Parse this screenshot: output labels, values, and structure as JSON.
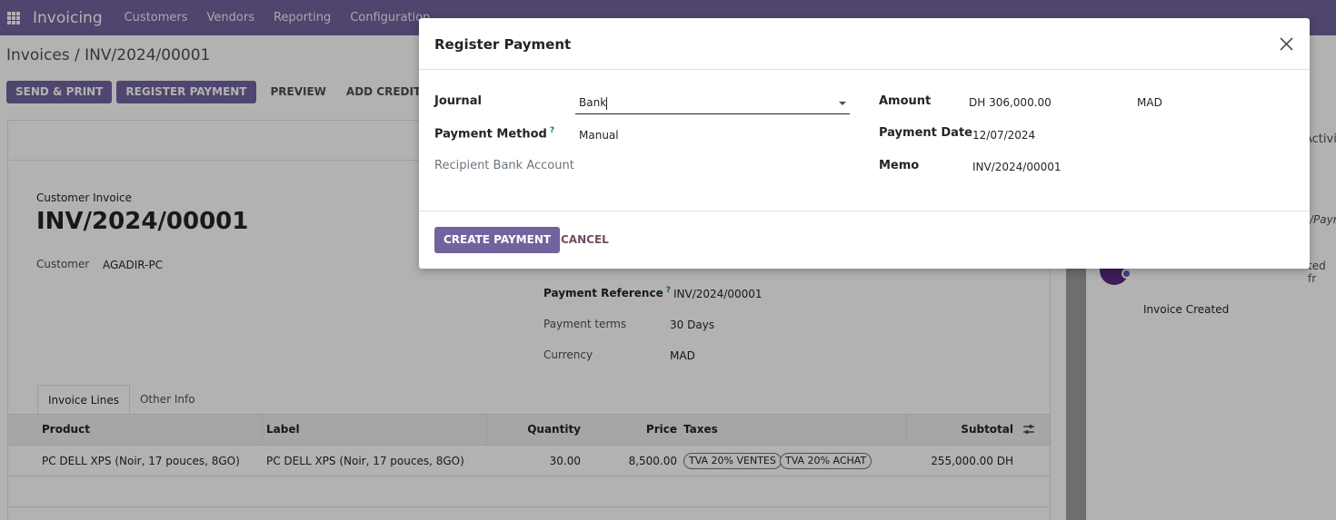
{
  "navbar": {
    "brand": "Invoicing",
    "menu": [
      "Customers",
      "Vendors",
      "Reporting",
      "Configuration"
    ]
  },
  "breadcrumb": "Invoices / INV/2024/00001",
  "actions": {
    "send_print": "SEND & PRINT",
    "register_payment": "REGISTER PAYMENT",
    "preview": "PREVIEW",
    "add_credit_note": "ADD CREDIT NOTE"
  },
  "invoice": {
    "type": "Customer Invoice",
    "name": "INV/2024/00001",
    "customer_label": "Customer",
    "customer": "AGADIR-PC",
    "payment_reference_label": "Payment Reference",
    "payment_reference": "INV/2024/00001",
    "payment_terms_label": "Payment terms",
    "payment_terms": "30 Days",
    "currency_label": "Currency",
    "currency": "MAD"
  },
  "tabs": [
    "Invoice Lines",
    "Other Info"
  ],
  "lines": {
    "headers": [
      "Product",
      "Label",
      "Quantity",
      "Price",
      "Taxes",
      "Subtotal"
    ],
    "rows": [
      {
        "product": "PC DELL XPS (Noir, 17 pouces, 8GO)",
        "label": "PC DELL XPS (Noir, 17 pouces, 8GO)",
        "quantity": "30.00",
        "price": "8,500.00",
        "taxes": [
          "TVA 20% VENTES",
          "TVA 20% ACHAT"
        ],
        "subtotal": "255,000.00 DH"
      }
    ]
  },
  "chatter": {
    "activities": "Activit",
    "payment_snip": "/Paym",
    "created_snip": "ted fr",
    "event": "Invoice Created"
  },
  "modal": {
    "title": "Register Payment",
    "journal_label": "Journal",
    "journal_value": "Bank",
    "payment_method_label": "Payment Method",
    "payment_method_value": "Manual",
    "recipient_bank_label": "Recipient Bank Account",
    "amount_label": "Amount",
    "amount_value": "DH 306,000.00",
    "amount_currency": "MAD",
    "payment_date_label": "Payment Date",
    "payment_date_value": "12/07/2024",
    "memo_label": "Memo",
    "memo_value": "INV/2024/00001",
    "create_label": "CREATE PAYMENT",
    "cancel_label": "CANCEL"
  },
  "colors": {
    "brand": "#71639e",
    "link": "#714b67",
    "help": "#017e84"
  }
}
